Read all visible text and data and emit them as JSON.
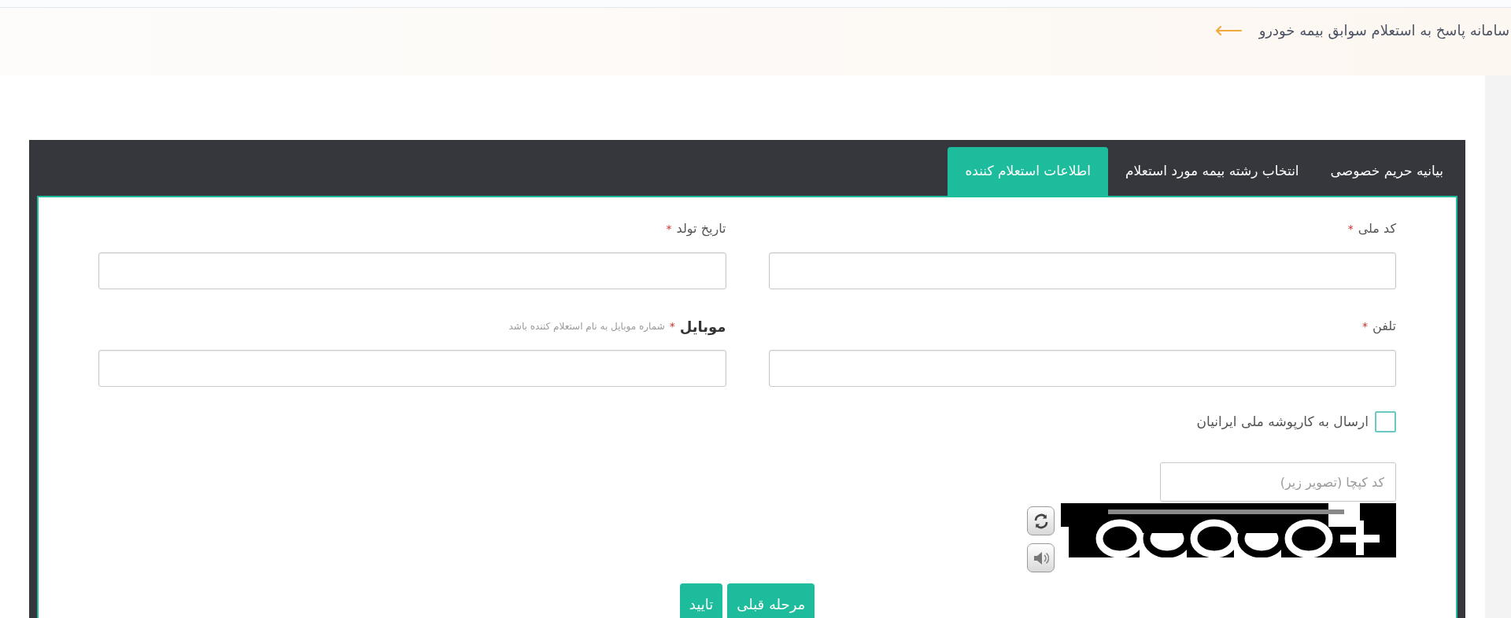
{
  "header": {
    "title": "سامانه پاسخ به استعلام سوابق بیمه خودرو"
  },
  "tabs": [
    {
      "label": "بیانیه حریم خصوصی",
      "selected": false
    },
    {
      "label": "انتخاب رشته بیمه مورد استعلام",
      "selected": false
    },
    {
      "label": "اطلاعات استعلام کننده",
      "selected": true
    }
  ],
  "form": {
    "fields": [
      {
        "label": "کد ملی",
        "required_mark": "*",
        "emphasized": false
      },
      {
        "label": "تاریخ تولد",
        "required_mark": "*",
        "emphasized": false
      },
      {
        "label": "تلفن",
        "required_mark": "*",
        "emphasized": false
      },
      {
        "label": "موبایل",
        "required_mark": "*",
        "emphasized": true,
        "hint": "شماره موبایل به نام استعلام کننده باشد"
      }
    ],
    "checkbox": {
      "label": "ارسال به کارپوشه ملی ایرانیان",
      "checked": false
    },
    "captcha": {
      "placeholder": "کد کپچا (تصویر زیر)"
    }
  },
  "buttons": [
    {
      "label": "مرحله قبلی"
    },
    {
      "label": "تایید"
    }
  ]
}
